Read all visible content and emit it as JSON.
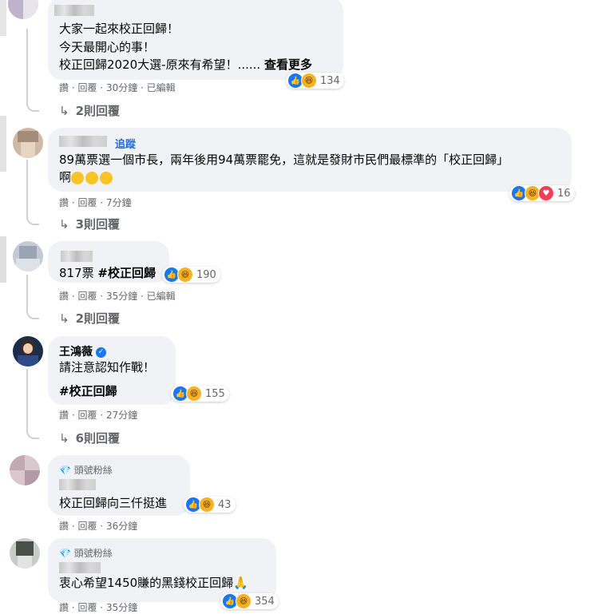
{
  "comments": [
    {
      "lines": [
        "大家一起來校正回歸！",
        "今天最開心的事！",
        "校正回歸2020大選-原來有希望！......"
      ],
      "see_more": "查看更多",
      "reactions": "134",
      "meta": {
        "like": "讚",
        "reply": "回覆",
        "time": "30分鐘",
        "edited": "已編輯"
      },
      "replies": "2則回覆"
    },
    {
      "follow": "追蹤",
      "lines": [
        "89萬票選一個市長，兩年後用94萬票罷免，這就是發財市民們最標準的「校正回歸」",
        "啊"
      ],
      "reactions": "16",
      "meta": {
        "like": "讚",
        "reply": "回覆",
        "time": "7分鐘"
      },
      "replies": "3則回覆"
    },
    {
      "text_plain": "817票 ",
      "text_bold": "#校正回歸",
      "reactions": "190",
      "meta": {
        "like": "讚",
        "reply": "回覆",
        "time": "35分鐘",
        "edited": "已編輯"
      },
      "replies": "2則回覆"
    },
    {
      "name": "王鴻薇",
      "line1": "請注意認知作戰！",
      "line2": "#校正回歸",
      "reactions": "155",
      "meta": {
        "like": "讚",
        "reply": "回覆",
        "time": "27分鐘"
      },
      "replies": "6則回覆"
    },
    {
      "badge": "頭號粉絲",
      "line1": "校正回歸向三仟挺進",
      "reactions": "43",
      "meta": {
        "like": "讚",
        "reply": "回覆",
        "time": "36分鐘"
      }
    },
    {
      "badge": "頭號粉絲",
      "line1": "衷心希望1450賺的黑錢校正回歸",
      "reactions": "354",
      "meta": {
        "like": "讚",
        "reply": "回覆",
        "time": "35分鐘"
      }
    }
  ],
  "colors": {
    "link": "#216fdb",
    "bubble": "#f0f2f5",
    "meta": "#65676b",
    "like": "#1877f2",
    "haha": "#f7b125",
    "love": "#f33e58"
  },
  "icons": {
    "like": "thumbs-up-icon",
    "haha": "laughing-face-icon",
    "love": "heart-icon",
    "reply_arrow": "reply-arrow-icon",
    "verified": "verified-check-icon",
    "diamond": "diamond-icon"
  }
}
